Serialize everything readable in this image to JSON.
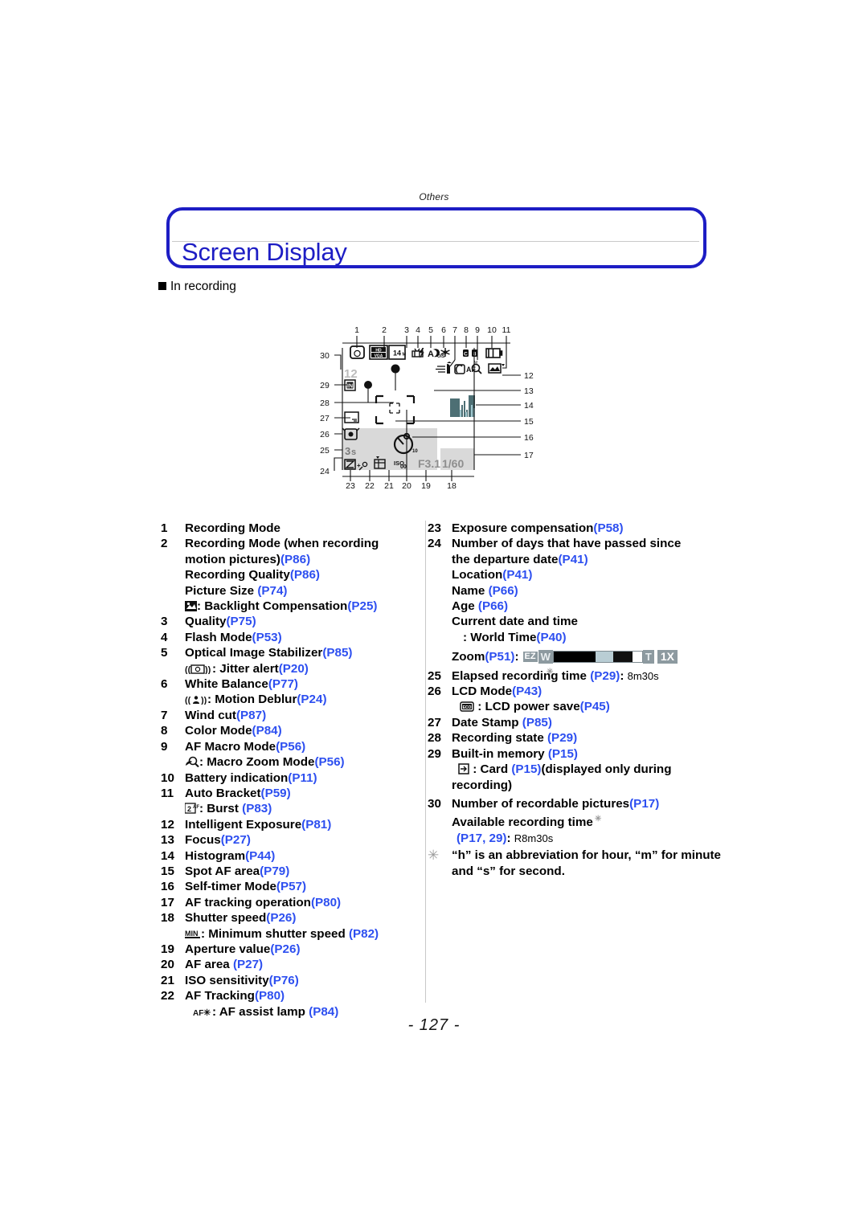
{
  "document": {
    "running_head": "Others",
    "title": "Screen Display",
    "subhead": "In recording",
    "page_number": "- 127 -"
  },
  "diagram": {
    "name": "camera-lcd-screen-callout-diagram",
    "top_callouts": [
      "1",
      "2",
      "3",
      "4",
      "5",
      "6",
      "7",
      "8",
      "9",
      "10",
      "11"
    ],
    "right_callouts": [
      "12",
      "13",
      "14",
      "15",
      "16",
      "17"
    ],
    "left_callouts": [
      "30",
      "29",
      "28",
      "27",
      "26",
      "25",
      "24"
    ],
    "bottom_callouts": [
      "23",
      "22",
      "21",
      "20",
      "19",
      "18"
    ],
    "screen_values": {
      "picture_size": "14M",
      "quality_mode_top": "HD",
      "quality_mode_bottom": "VGA",
      "burst_count": "12",
      "self_timer": "3s",
      "timer_value": "10",
      "iso_value": "00",
      "aperture": "F3.1",
      "shutter_speed": "1/60"
    }
  },
  "legend": {
    "left": [
      {
        "num": "1",
        "lines": [
          {
            "text": "Recording Mode",
            "page": ""
          }
        ]
      },
      {
        "num": "2",
        "lines": [
          {
            "text": "Recording Mode (when recording",
            "page": ""
          },
          {
            "text": "motion pictures)",
            "page": "(P86)",
            "indent": 1
          },
          {
            "text": "Recording Quality",
            "page": "(P86)",
            "indent": 1
          },
          {
            "text": "Picture Size ",
            "page": "(P74)",
            "indent": 1
          },
          {
            "icon": "backlight-compensation-icon",
            "text": ": Backlight Compensation",
            "page": "(P25)",
            "indent": 1
          }
        ]
      },
      {
        "num": "3",
        "lines": [
          {
            "text": "Quality",
            "page": "(P75)"
          }
        ]
      },
      {
        "num": "4",
        "lines": [
          {
            "text": "Flash Mode",
            "page": "(P53)"
          }
        ]
      },
      {
        "num": "5",
        "lines": [
          {
            "text": "Optical Image Stabilizer",
            "page": "(P85)"
          },
          {
            "icon": "jitter-alert-icon",
            "text": ": Jitter alert",
            "page": "(P20)",
            "indent": 1
          }
        ]
      },
      {
        "num": "6",
        "lines": [
          {
            "text": "White Balance",
            "page": "(P77)"
          },
          {
            "icon": "motion-deblur-icon",
            "text": ": Motion Deblur",
            "page": "(P24)",
            "indent": 1
          }
        ]
      },
      {
        "num": "7",
        "lines": [
          {
            "text": "Wind cut",
            "page": "(P87)"
          }
        ]
      },
      {
        "num": "8",
        "lines": [
          {
            "text": "Color Mode",
            "page": "(P84)"
          }
        ]
      },
      {
        "num": "9",
        "lines": [
          {
            "text": "AF Macro Mode",
            "page": "(P56)"
          },
          {
            "icon": "macro-zoom-icon",
            "text": ":  Macro Zoom Mode",
            "page": "(P56)",
            "indent": 1
          }
        ]
      },
      {
        "num": "10",
        "lines": [
          {
            "text": "Battery indication",
            "page": "(P11)"
          }
        ]
      },
      {
        "num": "11",
        "lines": [
          {
            "text": "Auto Bracket",
            "page": "(P59)"
          },
          {
            "icon": "burst-icon",
            "text": ": Burst ",
            "page": "(P83)",
            "indent": 1
          }
        ]
      },
      {
        "num": "12",
        "lines": [
          {
            "text": "Intelligent Exposure",
            "page": "(P81)"
          }
        ]
      },
      {
        "num": "13",
        "lines": [
          {
            "text": "Focus",
            "page": "(P27)"
          }
        ]
      },
      {
        "num": "14",
        "lines": [
          {
            "text": "Histogram",
            "page": "(P44)"
          }
        ]
      },
      {
        "num": "15",
        "lines": [
          {
            "text": "Spot AF area",
            "page": "(P79)"
          }
        ]
      },
      {
        "num": "16",
        "lines": [
          {
            "text": "Self-timer Mode",
            "page": "(P57)"
          }
        ]
      },
      {
        "num": "17",
        "lines": [
          {
            "text": "AF tracking operation",
            "page": "(P80)"
          }
        ]
      },
      {
        "num": "18",
        "lines": [
          {
            "text": "Shutter speed",
            "page": "(P26)"
          },
          {
            "icon": "min-shutter-icon",
            "text": ": Minimum shutter speed ",
            "page": "(P82)",
            "indent": 1
          }
        ]
      },
      {
        "num": "19",
        "lines": [
          {
            "text": "Aperture value",
            "page": "(P26)"
          }
        ]
      },
      {
        "num": "20",
        "lines": [
          {
            "text": "AF area ",
            "page": "(P27)"
          }
        ]
      },
      {
        "num": "21",
        "lines": [
          {
            "text": "ISO sensitivity",
            "page": "(P76)"
          }
        ]
      },
      {
        "num": "22",
        "lines": [
          {
            "text": "AF Tracking",
            "page": "(P80)"
          },
          {
            "icon": "af-assist-lamp-icon",
            "text": ":  AF assist lamp ",
            "page": "(P84)",
            "indent": 1
          }
        ]
      }
    ],
    "right": [
      {
        "num": "23",
        "lines": [
          {
            "text": "Exposure compensation",
            "page": "(P58)"
          }
        ]
      },
      {
        "num": "24",
        "lines": [
          {
            "text": "Number of days that have passed since",
            "page": ""
          },
          {
            "text": "the departure date",
            "page": "(P41)",
            "indent": 1
          },
          {
            "text": "Location",
            "page": "(P41)",
            "indent": 1
          },
          {
            "text": "Name ",
            "page": "(P66)",
            "indent": 1
          },
          {
            "text": "Age ",
            "page": "(P66)",
            "indent": 1
          },
          {
            "text": "Current date and time",
            "page": "",
            "indent": 1
          },
          {
            "text": ": World Time",
            "page": "(P40)",
            "indent": 2
          },
          {
            "text": "Zoom",
            "page": "(P51)",
            "suffix": ":",
            "indent": 1,
            "widget": "zoom-bar"
          }
        ]
      },
      {
        "num": "25",
        "lines": [
          {
            "text": "Elapsed recording time ",
            "page": "(P29)",
            "suffix": ":",
            "value": "8m30s",
            "star": true
          }
        ]
      },
      {
        "num": "26",
        "lines": [
          {
            "text": "LCD Mode",
            "page": "(P43)"
          },
          {
            "icon": "lcd-power-save-icon",
            "text": " : LCD power save",
            "page": "(P45)",
            "indent": 1
          }
        ]
      },
      {
        "num": "27",
        "lines": [
          {
            "text": "Date Stamp ",
            "page": "(P85)"
          }
        ]
      },
      {
        "num": "28",
        "lines": [
          {
            "text": "Recording state ",
            "page": "(P29)"
          }
        ]
      },
      {
        "num": "29",
        "lines": [
          {
            "text": "Built-in memory ",
            "page": "(P15)"
          },
          {
            "icon": "card-icon",
            "text": " : Card ",
            "page": "(P15)",
            "suffix": "(displayed only during",
            "indent": 1
          },
          {
            "text": "recording)",
            "page": "",
            "indent": 1
          }
        ]
      },
      {
        "num": "30",
        "lines": [
          {
            "text": "Number of recordable pictures",
            "page": "(P17)"
          },
          {
            "text": "Available recording time",
            "page": "",
            "indent": 1,
            "star": true
          },
          {
            "text": "",
            "page": "(P17, 29)",
            "suffix": ":",
            "value": "R8m30s",
            "indent": 1
          }
        ]
      }
    ],
    "footnote": {
      "marker": "✳",
      "text": "“h” is an abbreviation for hour, “m” for minute and “s” for second."
    },
    "zoom_widget": {
      "ez_label": "EZ",
      "w_label": "W",
      "t_label": "T",
      "magnification": "1X"
    }
  },
  "colors": {
    "accent_blue": "#1d1dc4",
    "page_ref_blue": "#2d4ff0",
    "text_black": "#000000"
  }
}
